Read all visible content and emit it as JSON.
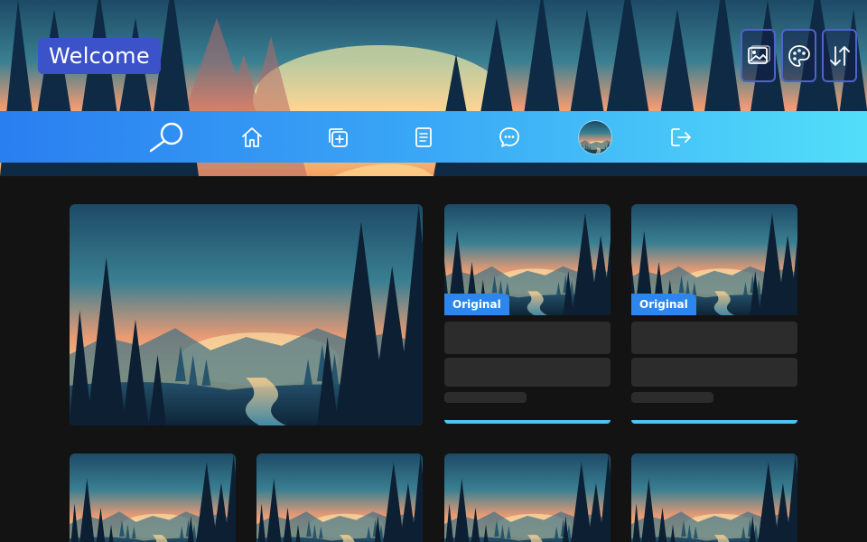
{
  "header": {
    "welcome_label": "Welcome",
    "actions": [
      {
        "icon": "image-icon"
      },
      {
        "icon": "palette-icon"
      },
      {
        "icon": "sort-arrows-icon"
      }
    ]
  },
  "nav": {
    "items": [
      {
        "icon": "search-icon"
      },
      {
        "icon": "home-icon"
      },
      {
        "icon": "add-copy-icon"
      },
      {
        "icon": "document-icon"
      },
      {
        "icon": "chat-icon"
      },
      {
        "icon": "avatar"
      },
      {
        "icon": "logout-icon"
      }
    ]
  },
  "cards": [
    {
      "badge": "Original"
    },
    {
      "badge": "Original"
    }
  ],
  "colors": {
    "nav_gradient_start": "#2a7ef0",
    "nav_gradient_end": "#52def9",
    "welcome_bg": "#3b52c9",
    "badge_bg": "#2c86ec",
    "underline": "#4cc4f2",
    "background": "#131313"
  }
}
